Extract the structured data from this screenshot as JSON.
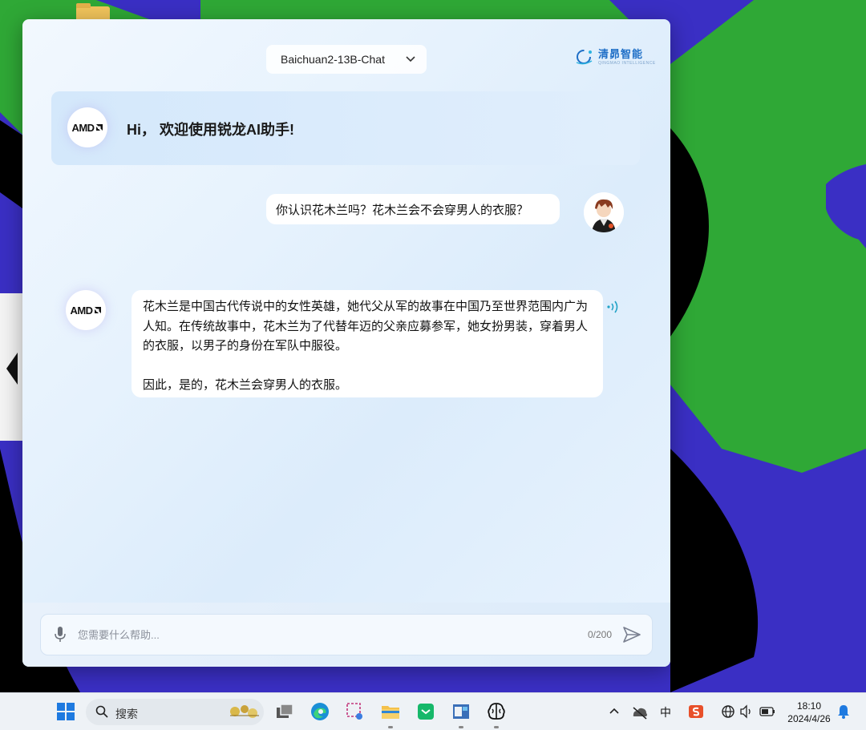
{
  "window": {
    "model_selector": "Baichuan2-13B-Chat",
    "brand_name": "清昴智能",
    "brand_sub": "QINGMAO INTELLIGENCE",
    "welcome_text": "Hi， 欢迎使用锐龙AI助手!",
    "bot_avatar_text": "AMD"
  },
  "chat": {
    "user_message": "你认识花木兰吗？花木兰会不会穿男人的衣服？",
    "bot_paragraph_1": "花木兰是中国古代传说中的女性英雄，她代父从军的故事在中国乃至世界范围内广为人知。在传统故事中，花木兰为了代替年迈的父亲应募参军，她女扮男装，穿着男人的衣服，以男子的身份在军队中服役。",
    "bot_paragraph_2": "因此，是的，花木兰会穿男人的衣服。"
  },
  "composer": {
    "placeholder": "您需要什么帮助...",
    "counter": "0/200"
  },
  "taskbar": {
    "search_label": "搜索",
    "ime_label": "中",
    "time": "18:10",
    "date": "2024/4/26"
  },
  "icons": {
    "model_chevron": "chevron-down-icon",
    "speaker": "speaker-icon",
    "mic": "microphone-icon",
    "send": "send-icon",
    "start": "windows-start-icon",
    "search": "search-icon"
  },
  "colors": {
    "brand_blue": "#1f6fc7",
    "speaker_teal": "#22a3c7",
    "wallpaper_blue": "#3a2fc4",
    "wallpaper_green": "#2fa836"
  }
}
